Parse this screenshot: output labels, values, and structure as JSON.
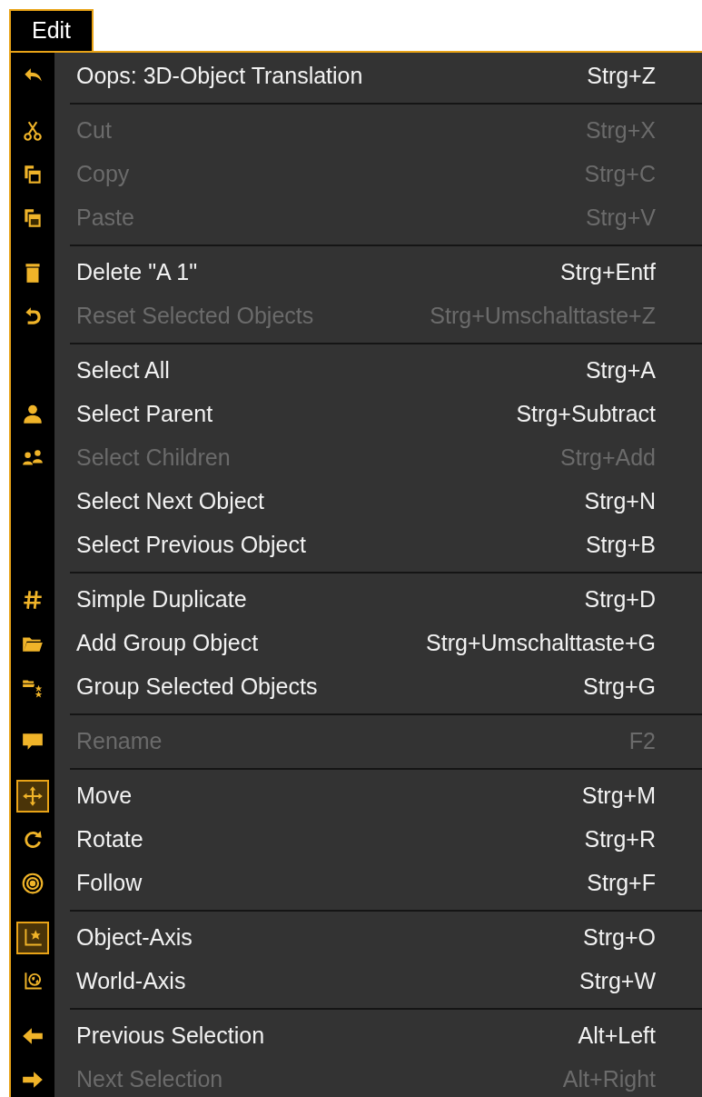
{
  "menu_bar": {
    "title": "Edit"
  },
  "groups": [
    [
      {
        "kind": "undo",
        "label": "Oops: 3D-Object Translation",
        "shortcut": "Strg+Z",
        "disabled": false
      }
    ],
    [
      {
        "kind": "cut",
        "label": "Cut",
        "shortcut": "Strg+X",
        "disabled": true
      },
      {
        "kind": "copy",
        "label": "Copy",
        "shortcut": "Strg+C",
        "disabled": true
      },
      {
        "kind": "paste",
        "label": "Paste",
        "shortcut": "Strg+V",
        "disabled": true
      }
    ],
    [
      {
        "kind": "trash",
        "label": "Delete \"A 1\"",
        "shortcut": "Strg+Entf",
        "disabled": false
      },
      {
        "kind": "reset",
        "label": "Reset Selected Objects",
        "shortcut": "Strg+Umschalttaste+Z",
        "disabled": true
      }
    ],
    [
      {
        "label": "Select All",
        "shortcut": "Strg+A",
        "disabled": false
      },
      {
        "kind": "person",
        "label": "Select Parent",
        "shortcut": "Strg+Subtract",
        "disabled": false
      },
      {
        "kind": "people",
        "label": "Select Children",
        "shortcut": "Strg+Add",
        "disabled": true
      },
      {
        "label": "Select Next Object",
        "shortcut": "Strg+N",
        "disabled": false
      },
      {
        "label": "Select Previous Object",
        "shortcut": "Strg+B",
        "disabled": false
      }
    ],
    [
      {
        "kind": "hash",
        "label": "Simple Duplicate",
        "shortcut": "Strg+D",
        "disabled": false
      },
      {
        "kind": "folder",
        "label": "Add Group Object",
        "shortcut": "Strg+Umschalttaste+G",
        "disabled": false
      },
      {
        "kind": "folder-star",
        "label": "Group Selected Objects",
        "shortcut": "Strg+G",
        "disabled": false
      }
    ],
    [
      {
        "kind": "comment",
        "label": "Rename",
        "shortcut": "F2",
        "disabled": true
      }
    ],
    [
      {
        "kind": "move",
        "label": "Move",
        "shortcut": "Strg+M",
        "disabled": false,
        "checked": true
      },
      {
        "kind": "rotate",
        "label": "Rotate",
        "shortcut": "Strg+R",
        "disabled": false,
        "checked": false
      },
      {
        "kind": "target",
        "label": "Follow",
        "shortcut": "Strg+F",
        "disabled": false,
        "checked": false
      }
    ],
    [
      {
        "kind": "object-axis",
        "label": "Object-Axis",
        "shortcut": "Strg+O",
        "disabled": false,
        "checked": true
      },
      {
        "kind": "world-axis",
        "label": "World-Axis",
        "shortcut": "Strg+W",
        "disabled": false,
        "checked": false
      }
    ],
    [
      {
        "kind": "arrow-left",
        "label": "Previous Selection",
        "shortcut": "Alt+Left",
        "disabled": false
      },
      {
        "kind": "arrow-right",
        "label": "Next Selection",
        "shortcut": "Alt+Right",
        "disabled": true
      }
    ]
  ]
}
